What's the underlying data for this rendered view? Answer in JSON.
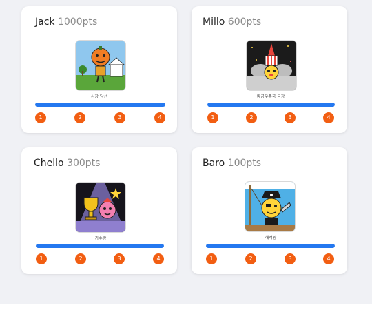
{
  "cards": [
    {
      "name": "Jack",
      "points": "1000pts",
      "badge": {
        "label": "시장 당선",
        "icon": "pumpkin-mayor-icon"
      },
      "progress": 1.0,
      "steps": [
        "1",
        "2",
        "3",
        "4"
      ]
    },
    {
      "name": "Millo",
      "points": "600pts",
      "badge": {
        "label": "황금우주국 국장",
        "icon": "space-astronaut-icon"
      },
      "progress": 1.0,
      "steps": [
        "1",
        "2",
        "3",
        "4"
      ]
    },
    {
      "name": "Chello",
      "points": "300pts",
      "badge": {
        "label": "가수왕",
        "icon": "singer-trophy-icon"
      },
      "progress": 1.0,
      "steps": [
        "1",
        "2",
        "3",
        "4"
      ]
    },
    {
      "name": "Baro",
      "points": "100pts",
      "badge": {
        "label": "해적왕",
        "icon": "pirate-king-icon"
      },
      "progress": 1.0,
      "steps": [
        "1",
        "2",
        "3",
        "4"
      ]
    }
  ],
  "colors": {
    "progress": "#2478f0",
    "step": "#f25e12",
    "background": "#f0f1f5"
  }
}
